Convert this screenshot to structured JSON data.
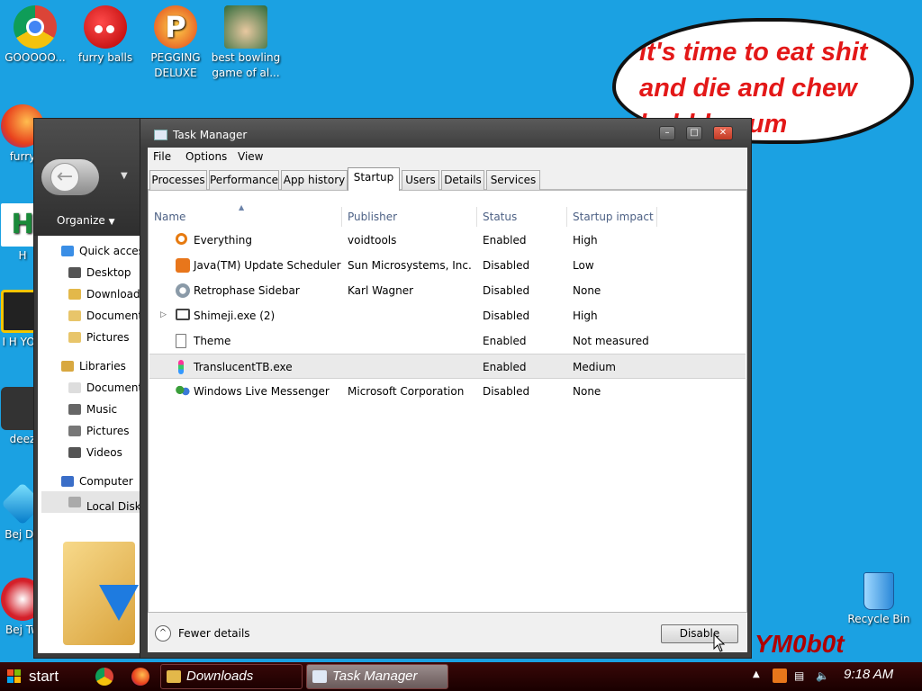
{
  "desktop": {
    "icons": [
      {
        "label": "GOOOOO...",
        "name": "chrome-desktop-icon"
      },
      {
        "label": "furry balls",
        "name": "furry-balls-icon"
      },
      {
        "label": "PEGGING DELUXE",
        "name": "pegging-deluxe-icon"
      },
      {
        "label": "best bowling game of al...",
        "name": "bowling-game-icon"
      },
      {
        "label": "furry",
        "name": "firefox-desktop-icon"
      },
      {
        "label": "H",
        "name": "h-app-icon"
      },
      {
        "label": "I H YOU",
        "name": "i-h-you-icon"
      },
      {
        "label": "deez",
        "name": "deez-icon"
      },
      {
        "label": "Bej De",
        "name": "bejeweled-deluxe-icon"
      },
      {
        "label": "Bej Tw",
        "name": "bejeweled-twist-icon"
      },
      {
        "label": "Recycle Bin",
        "name": "recycle-bin-icon"
      }
    ],
    "bubble_text": "it's time to eat shit and die and chew bubble gum",
    "watermark": "YM0b0t"
  },
  "explorer": {
    "organize_label": "Organize",
    "tree": [
      {
        "label": "Quick access",
        "icon": "star-icon"
      },
      {
        "label": "Desktop",
        "icon": "desktop-icon"
      },
      {
        "label": "Downloads",
        "icon": "downloads-icon"
      },
      {
        "label": "Documents",
        "icon": "documents-icon"
      },
      {
        "label": "Pictures",
        "icon": "pictures-icon"
      },
      {
        "label": "Libraries",
        "icon": "libraries-icon"
      },
      {
        "label": "Documents",
        "icon": "documents-icon"
      },
      {
        "label": "Music",
        "icon": "music-icon"
      },
      {
        "label": "Pictures",
        "icon": "pictures-icon"
      },
      {
        "label": "Videos",
        "icon": "videos-icon"
      },
      {
        "label": "Computer",
        "icon": "computer-icon"
      },
      {
        "label": "Local Disk",
        "icon": "local-disk-icon"
      }
    ]
  },
  "task_manager": {
    "title": "Task Manager",
    "menu": [
      "File",
      "Options",
      "View"
    ],
    "tabs": [
      "Processes",
      "Performance",
      "App history",
      "Startup",
      "Users",
      "Details",
      "Services"
    ],
    "active_tab": "Startup",
    "columns": [
      "Name",
      "Publisher",
      "Status",
      "Startup impact"
    ],
    "rows": [
      {
        "name": "Everything",
        "publisher": "voidtools",
        "status": "Enabled",
        "impact": "High",
        "icon": "magnifier-icon"
      },
      {
        "name": "Java(TM) Update Scheduler",
        "publisher": "Sun Microsystems, Inc.",
        "status": "Disabled",
        "impact": "Low",
        "icon": "java-icon"
      },
      {
        "name": "Retrophase Sidebar",
        "publisher": "Karl Wagner",
        "status": "Disabled",
        "impact": "None",
        "icon": "gear-icon"
      },
      {
        "name": "Shimeji.exe (2)",
        "publisher": "",
        "status": "Disabled",
        "impact": "High",
        "icon": "monitor-icon"
      },
      {
        "name": "Theme",
        "publisher": "",
        "status": "Enabled",
        "impact": "Not measured",
        "icon": "file-icon"
      },
      {
        "name": "TranslucentTB.exe",
        "publisher": "",
        "status": "Enabled",
        "impact": "Medium",
        "icon": "translucenttb-icon"
      },
      {
        "name": "Windows Live Messenger",
        "publisher": "Microsoft Corporation",
        "status": "Disabled",
        "impact": "None",
        "icon": "messenger-icon"
      }
    ],
    "selected_row": "TranslucentTB.exe",
    "fewer_details": "Fewer details",
    "disable_label": "Disable"
  },
  "taskbar": {
    "start_label": "start",
    "tasks": [
      {
        "label": "Downloads",
        "active": false
      },
      {
        "label": "Task Manager",
        "active": true
      }
    ],
    "clock": "9:18 AM"
  }
}
